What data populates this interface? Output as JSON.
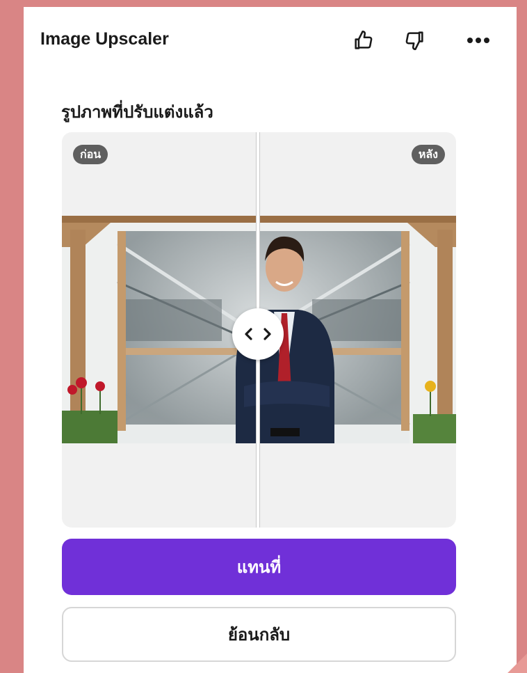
{
  "app": {
    "title": "Image Upscaler"
  },
  "header_icons": [
    "thumbs-up-icon",
    "thumbs-down-icon",
    "more-icon"
  ],
  "section": {
    "title": "รูปภาพที่ปรับแต่งแล้ว"
  },
  "compare": {
    "before_label": "ก่อน",
    "after_label": "หลัง",
    "slider_position": 0.5
  },
  "actions": {
    "replace_label": "แทนที่",
    "back_label": "ย้อนกลับ"
  },
  "colors": {
    "background": "#d98585",
    "accent": "#7030d8",
    "badge": "#5f5f5f"
  }
}
